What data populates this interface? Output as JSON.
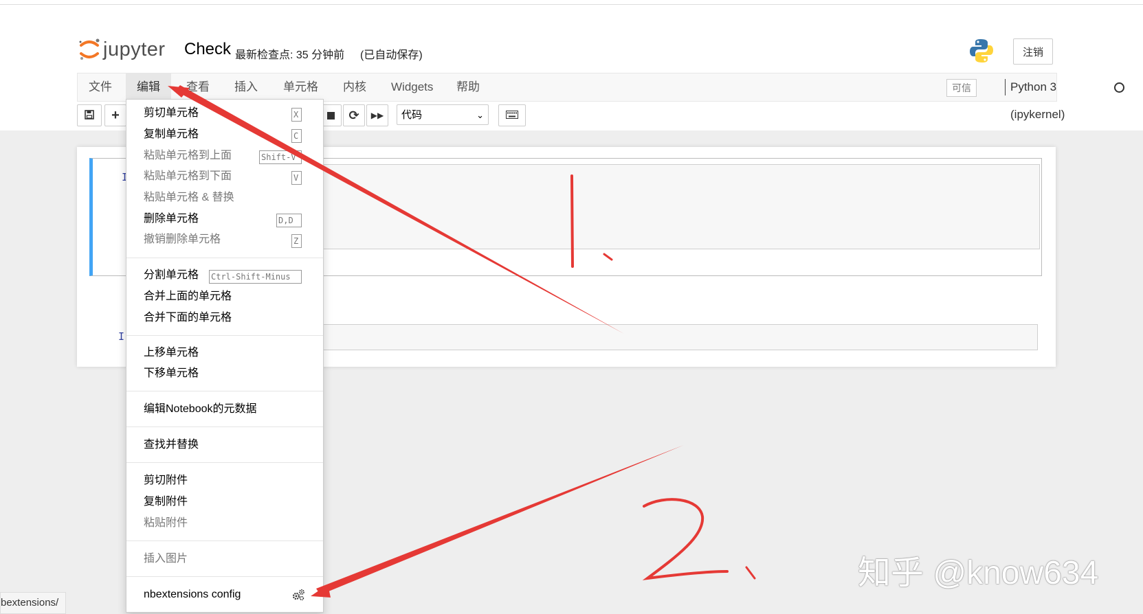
{
  "header": {
    "logo_text": "jupyter",
    "notebook_name": "Check",
    "checkpoint": "最新检查点: 35 分钟前",
    "autosave": "(已自动保存)",
    "logout_label": "注销"
  },
  "menubar": {
    "items": [
      "文件",
      "编辑",
      "查看",
      "插入",
      "单元格",
      "内核",
      "Widgets",
      "帮助"
    ],
    "active": "编辑",
    "trusted_label": "可信",
    "kernel_name": "Python 3 (ipykernel)"
  },
  "toolbar": {
    "cell_type": "代码"
  },
  "cells": {
    "cell1_prompt": "I",
    "cell2_prompt": "I"
  },
  "edit_menu": {
    "items": [
      {
        "label": "剪切单元格",
        "shortcut": "X",
        "disabled": false
      },
      {
        "label": "复制单元格",
        "shortcut": "C",
        "disabled": false
      },
      {
        "label": "粘贴单元格到上面",
        "shortcut": "Shift-V",
        "disabled": true
      },
      {
        "label": "粘贴单元格到下面",
        "shortcut": "V",
        "disabled": true
      },
      {
        "label": "粘贴单元格 & 替换",
        "shortcut": "",
        "disabled": true
      },
      {
        "label": "删除单元格",
        "shortcut": "D,D",
        "disabled": false
      },
      {
        "label": "撤销删除单元格",
        "shortcut": "Z",
        "disabled": true
      },
      {
        "label": "分割单元格",
        "shortcut": "Ctrl-Shift-Minus",
        "disabled": false
      },
      {
        "label": "合并上面的单元格",
        "shortcut": "",
        "disabled": false
      },
      {
        "label": "合并下面的单元格",
        "shortcut": "",
        "disabled": false
      },
      {
        "label": "上移单元格",
        "shortcut": "",
        "disabled": false
      },
      {
        "label": "下移单元格",
        "shortcut": "",
        "disabled": false
      },
      {
        "label": "编辑Notebook的元数据",
        "shortcut": "",
        "disabled": false
      },
      {
        "label": "查找并替换",
        "shortcut": "",
        "disabled": false
      },
      {
        "label": "剪切附件",
        "shortcut": "",
        "disabled": false
      },
      {
        "label": "复制附件",
        "shortcut": "",
        "disabled": false
      },
      {
        "label": "粘贴附件",
        "shortcut": "",
        "disabled": true
      },
      {
        "label": "插入图片",
        "shortcut": "",
        "disabled": true
      },
      {
        "label": "nbextensions config",
        "shortcut": "",
        "disabled": false
      }
    ]
  },
  "statusbar": {
    "url": "bextensions/"
  },
  "watermark": "知乎 @know634",
  "colors": {
    "accent": "#42a5f5",
    "annotation": "#e53935"
  }
}
